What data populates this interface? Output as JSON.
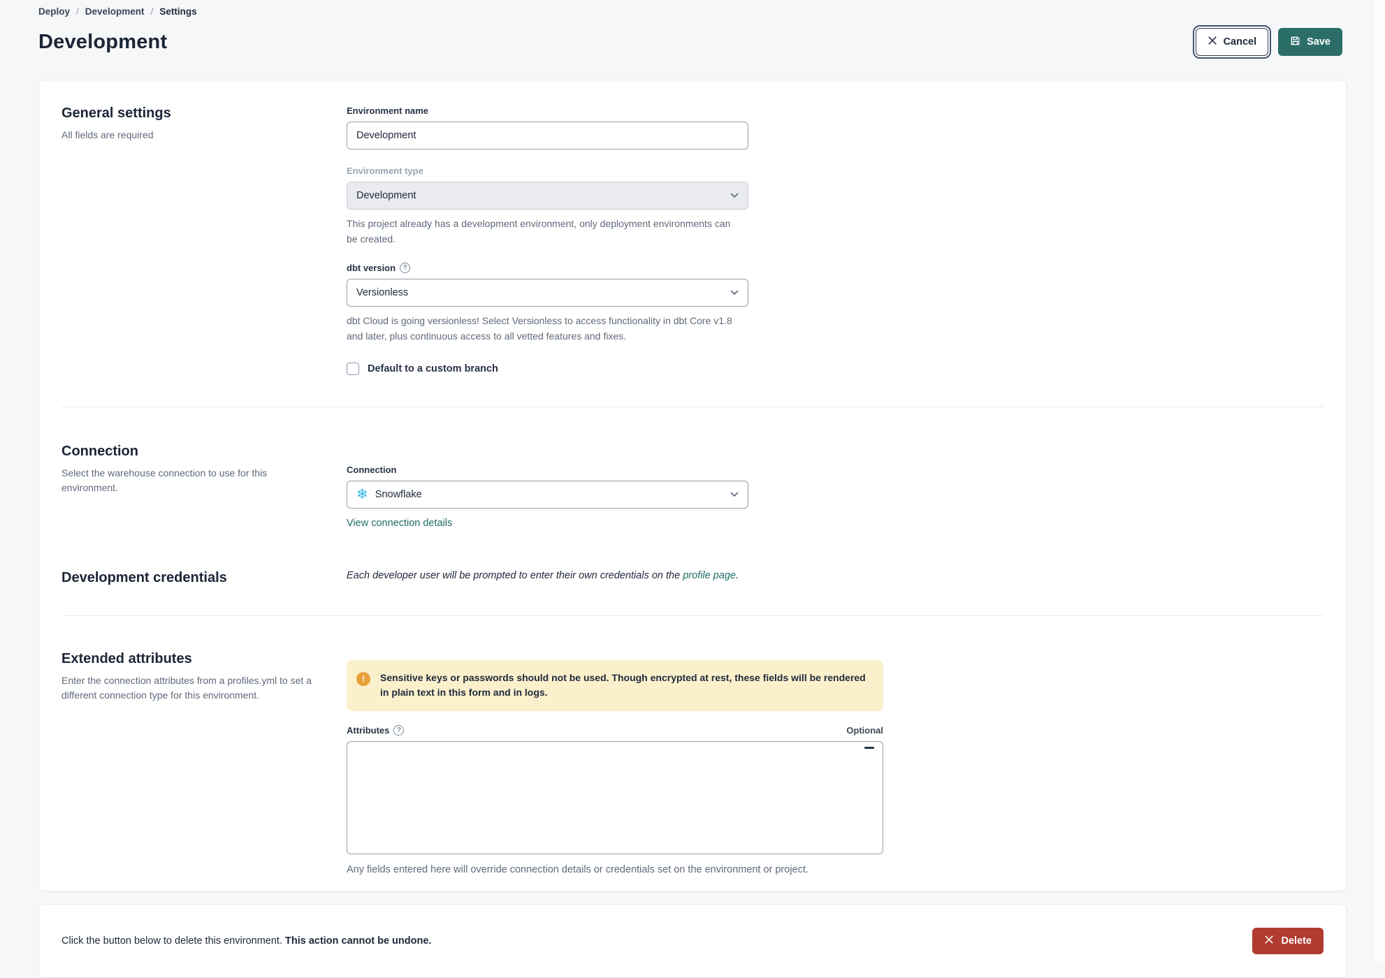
{
  "page": {
    "breadcrumb": [
      {
        "label": "Deploy"
      },
      {
        "label": "Development"
      },
      {
        "label": "Settings"
      }
    ],
    "breadcrumb_separator": "/",
    "title": "Development",
    "actions": {
      "cancel_label": "Cancel",
      "save_label": "Save"
    }
  },
  "general": {
    "heading": "General settings",
    "subheading": "All fields are required",
    "environment_name": {
      "label": "Environment name",
      "value": "Development"
    },
    "environment_type": {
      "label": "Environment type",
      "value": "Development",
      "help": "This project already has a development environment, only deployment environments can be created."
    },
    "dbt_version": {
      "label": "dbt version",
      "value": "Versionless",
      "help": "dbt Cloud is going versionless! Select Versionless to access functionality in dbt Core v1.8 and later, plus continuous access to all vetted features and fixes."
    },
    "custom_branch": {
      "label": "Default to a custom branch",
      "checked": false
    }
  },
  "connection": {
    "heading": "Connection",
    "subheading": "Select the warehouse connection to use for this environment.",
    "field_label": "Connection",
    "value": "Snowflake",
    "link_label": "View connection details"
  },
  "credentials": {
    "heading": "Development credentials",
    "note_prefix": "Each developer user will be prompted to enter their own credentials on the ",
    "note_link": "profile page",
    "note_suffix": "."
  },
  "extended": {
    "heading": "Extended attributes",
    "subheading": "Enter the connection attributes from a profiles.yml to set a different connection type for this environment.",
    "warning_text": "Sensitive keys or passwords should not be used. Though encrypted at rest, these fields will be rendered in plain text in this form and in logs.",
    "attributes_label": "Attributes",
    "optional_label": "Optional",
    "attributes_value": "",
    "help": "Any fields entered here will override connection details or credentials set on the environment or project."
  },
  "danger": {
    "text_prefix": "Click the button below to delete this environment. ",
    "text_bold": "This action cannot be undone.",
    "delete_label": "Delete"
  },
  "icons": {
    "snowflake_glyph": "❄",
    "help_glyph": "?",
    "warning_glyph": "!"
  },
  "colors": {
    "accent_teal": "#2B6E68",
    "link_teal": "#1F6E66",
    "danger_red": "#B13B31",
    "warning_bg": "#FAF1CC",
    "warning_icon": "#E9A13B",
    "snowflake_blue": "#29B5E8"
  }
}
